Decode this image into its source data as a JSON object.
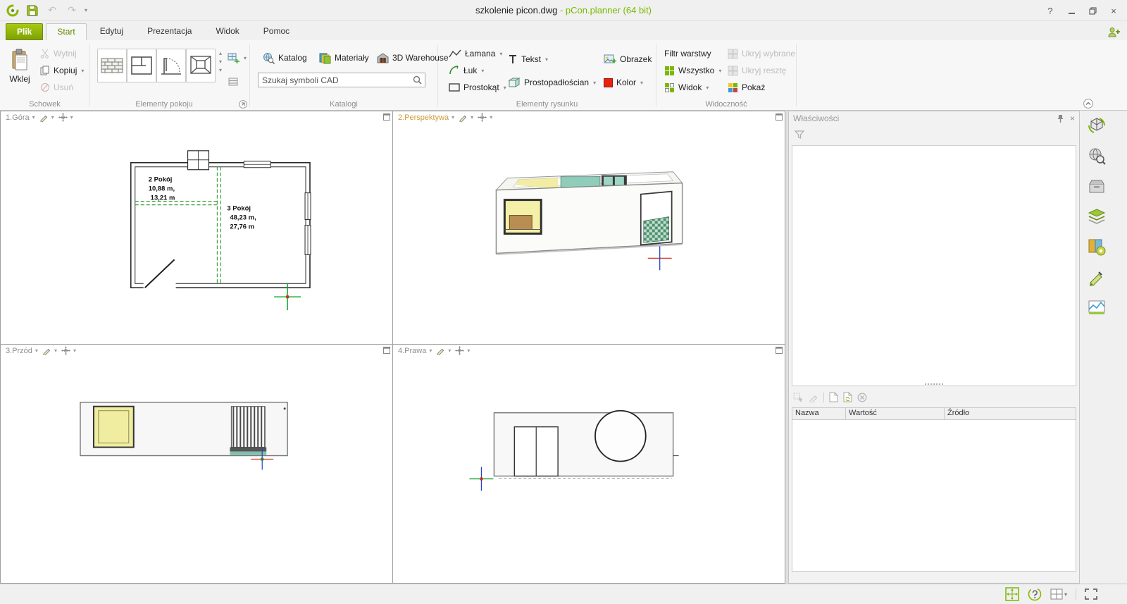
{
  "icons": {
    "caret_down": "▾",
    "caret_up": "▴",
    "undo": "↶",
    "redo": "↷",
    "close": "×"
  },
  "titlebar": {
    "title": "szkolenie picon.dwg",
    "app_suffix": " - pCon.planner (64 bit)",
    "help": "?"
  },
  "tabs": {
    "file": "Plik",
    "start": "Start",
    "edit": "Edytuj",
    "presentation": "Prezentacja",
    "view": "Widok",
    "help": "Pomoc"
  },
  "ribbon": {
    "clipboard": {
      "group_label": "Schowek",
      "paste": "Wklej",
      "cut": "Wytnij",
      "copy": "Kopiuj",
      "delete": "Usuń"
    },
    "room_elements": {
      "group_label": "Elementy pokoju"
    },
    "catalogs": {
      "group_label": "Katalogi",
      "catalog": "Katalog",
      "materials": "Materiały",
      "warehouse": "3D Warehouse",
      "search_placeholder": "Szukaj symboli CAD"
    },
    "drawing": {
      "group_label": "Elementy rysunku",
      "polyline": "Łamana",
      "arc": "Łuk",
      "rectangle": "Prostokąt",
      "text": "Tekst",
      "cuboid": "Prostopadłościan",
      "image": "Obrazek",
      "color": "Kolor"
    },
    "visibility": {
      "group_label": "Widoczność",
      "layer_filter": "Filtr warstwy",
      "all": "Wszystko",
      "view": "Widok",
      "hide_selected": "Ukryj wybrane",
      "hide_rest": "Ukryj resztę",
      "show": "Pokaż"
    }
  },
  "viewports": {
    "v1": {
      "label": "1.Góra"
    },
    "v2": {
      "label": "2.Perspektywa"
    },
    "v3": {
      "label": "3.Przód"
    },
    "v4": {
      "label": "4.Prawa"
    }
  },
  "floorplan": {
    "room2_name": "2 Pokój",
    "room2_area": "10,88 m,",
    "room2_perimeter": "13,21 m",
    "room3_name": "3 Pokój",
    "room3_area": "48,23 m,",
    "room3_perimeter": "27,76 m"
  },
  "properties": {
    "title": "Właściwości",
    "col_name": "Nazwa",
    "col_value": "Wartość",
    "col_source": "Źródło"
  },
  "colors": {
    "accent_green": "#8cb400",
    "active_viewport_label": "#cf9b3a",
    "color_swatch_red": "#e8220f",
    "interior_wall_dashed_green": "#3aa03a"
  }
}
